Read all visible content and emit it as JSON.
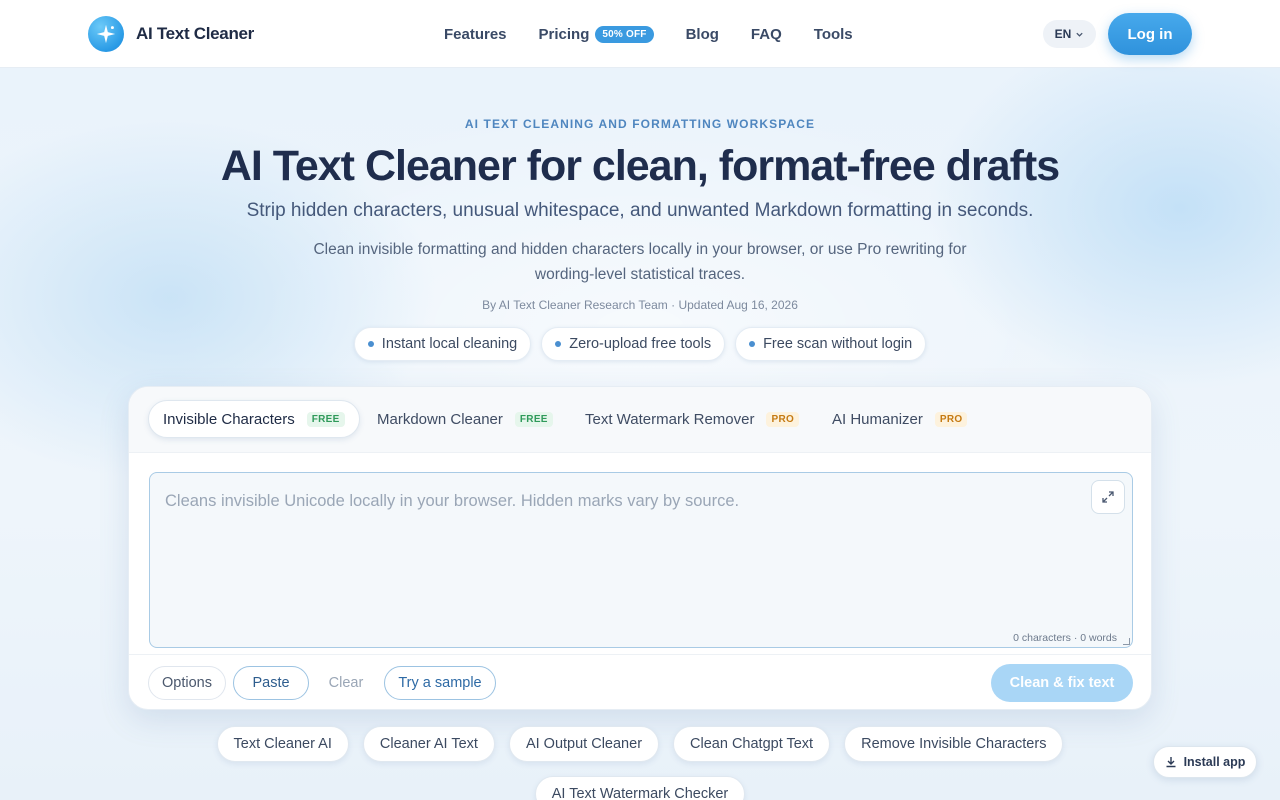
{
  "nav": {
    "brand": "AI Text Cleaner",
    "items": [
      {
        "label": "Features"
      },
      {
        "label": "Pricing",
        "badge": "50% OFF"
      },
      {
        "label": "Blog"
      },
      {
        "label": "FAQ"
      },
      {
        "label": "Tools"
      }
    ],
    "language": "EN",
    "login": "Log in"
  },
  "hero": {
    "eyebrow": "AI TEXT CLEANING AND FORMATTING WORKSPACE",
    "title": "AI Text Cleaner for clean, format-free drafts",
    "subtitle": "Strip hidden characters, unusual whitespace, and unwanted Markdown formatting in seconds.",
    "description": "Clean invisible formatting and hidden characters locally in your browser, or use Pro rewriting for wording-level statistical traces.",
    "byline": "By AI Text Cleaner Research Team · Updated Aug 16, 2026",
    "chips": [
      "Instant local cleaning",
      "Zero-upload free tools",
      "Free scan without login"
    ]
  },
  "tool": {
    "tabs": [
      {
        "label": "Invisible Characters",
        "tag": "FREE"
      },
      {
        "label": "Markdown Cleaner",
        "tag": "FREE"
      },
      {
        "label": "Text Watermark Remover",
        "tag": "PRO"
      },
      {
        "label": "AI Humanizer",
        "tag": "PRO"
      }
    ],
    "placeholder": "Cleans invisible Unicode locally in your browser. Hidden marks vary by source.",
    "counter": "0 characters · 0 words",
    "options": "Options",
    "paste": "Paste",
    "clear": "Clear",
    "sample": "Try a sample",
    "clean": "Clean & fix text"
  },
  "related": [
    "Text Cleaner AI",
    "Cleaner AI Text",
    "AI Output Cleaner",
    "Clean Chatgpt Text",
    "Remove Invisible Characters",
    "AI Text Watermark Checker"
  ],
  "install": "Install app",
  "colors": {
    "accent": "#2f92dc",
    "free": "#2f9a5a",
    "pro": "#c57a12"
  }
}
